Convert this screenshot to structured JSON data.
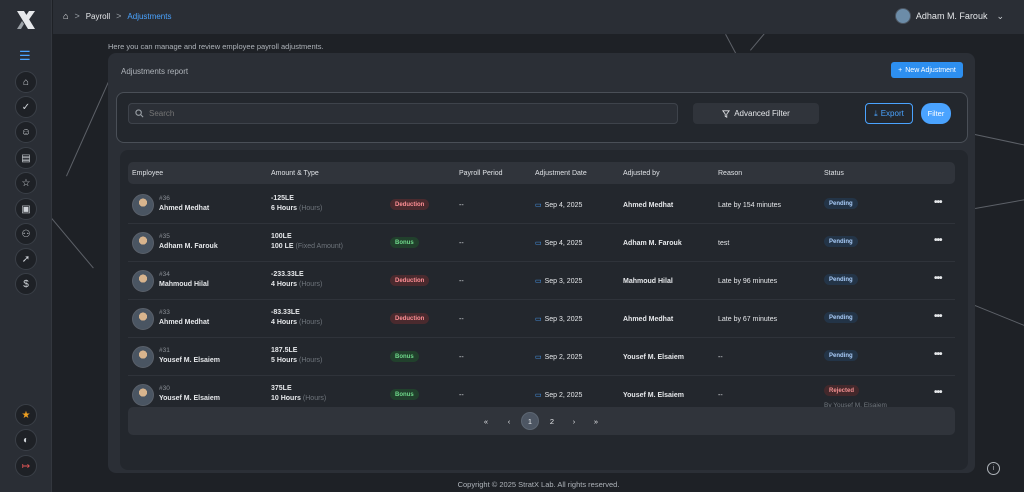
{
  "breadcrumb": {
    "items": [
      "Payroll",
      "Adjustments"
    ],
    "separator": ">"
  },
  "user": {
    "name": "Adham M. Farouk"
  },
  "page": {
    "subtitle": "Here you can manage and review employee payroll adjustments."
  },
  "report": {
    "title": "Adjustments report",
    "new_button": "New Adjustment",
    "search_placeholder": "Search",
    "advanced_filter": "Advanced Filter",
    "export": "Export",
    "filter": "Filter"
  },
  "table": {
    "headers": [
      "Employee",
      "Amount & Type",
      "Payroll Period",
      "Adjustment Date",
      "Adjusted by",
      "Reason",
      "Status"
    ],
    "rows": [
      {
        "id": "#36",
        "name": "Ahmed Medhat",
        "amount": "-125LE",
        "qty": "6 Hours",
        "unit": "(Hours)",
        "type": "Deduction",
        "period": "--",
        "date": "Sep 4, 2025",
        "adjusted_by": "Ahmed Medhat",
        "reason": "Late by 154 minutes",
        "status": "Pending",
        "status_note": ""
      },
      {
        "id": "#35",
        "name": "Adham M. Farouk",
        "amount": "100LE",
        "qty": "100 LE",
        "unit": "(Fixed Amount)",
        "type": "Bonus",
        "period": "--",
        "date": "Sep 4, 2025",
        "adjusted_by": "Adham M. Farouk",
        "reason": "test",
        "status": "Pending",
        "status_note": ""
      },
      {
        "id": "#34",
        "name": "Mahmoud Hilal",
        "amount": "-233.33LE",
        "qty": "4 Hours",
        "unit": "(Hours)",
        "type": "Deduction",
        "period": "--",
        "date": "Sep 3, 2025",
        "adjusted_by": "Mahmoud Hilal",
        "reason": "Late by 96 minutes",
        "status": "Pending",
        "status_note": ""
      },
      {
        "id": "#33",
        "name": "Ahmed Medhat",
        "amount": "-83.33LE",
        "qty": "4 Hours",
        "unit": "(Hours)",
        "type": "Deduction",
        "period": "--",
        "date": "Sep 3, 2025",
        "adjusted_by": "Ahmed Medhat",
        "reason": "Late by 67 minutes",
        "status": "Pending",
        "status_note": ""
      },
      {
        "id": "#31",
        "name": "Yousef M. Elsaiem",
        "amount": "187.5LE",
        "qty": "5 Hours",
        "unit": "(Hours)",
        "type": "Bonus",
        "period": "--",
        "date": "Sep 2, 2025",
        "adjusted_by": "Yousef M. Elsaiem",
        "reason": "--",
        "status": "Pending",
        "status_note": ""
      },
      {
        "id": "#30",
        "name": "Yousef M. Elsaiem",
        "amount": "375LE",
        "qty": "10 Hours",
        "unit": "(Hours)",
        "type": "Bonus",
        "period": "--",
        "date": "Sep 2, 2025",
        "adjusted_by": "Yousef M. Elsaiem",
        "reason": "--",
        "status": "Rejected",
        "status_note": "By Yousef M. Elsaiem"
      }
    ]
  },
  "pagination": {
    "first": "«",
    "prev": "‹",
    "pages": [
      "1",
      "2"
    ],
    "current": "1",
    "next": "›",
    "last": "»"
  },
  "footer": {
    "copyright": "Copyright © 2025 StratX Lab. All rights reserved."
  },
  "colors": {
    "accent": "#4aa3ff",
    "primary_button": "#2d8ff0",
    "background": "#1e2126",
    "panel": "#2b2f36"
  }
}
